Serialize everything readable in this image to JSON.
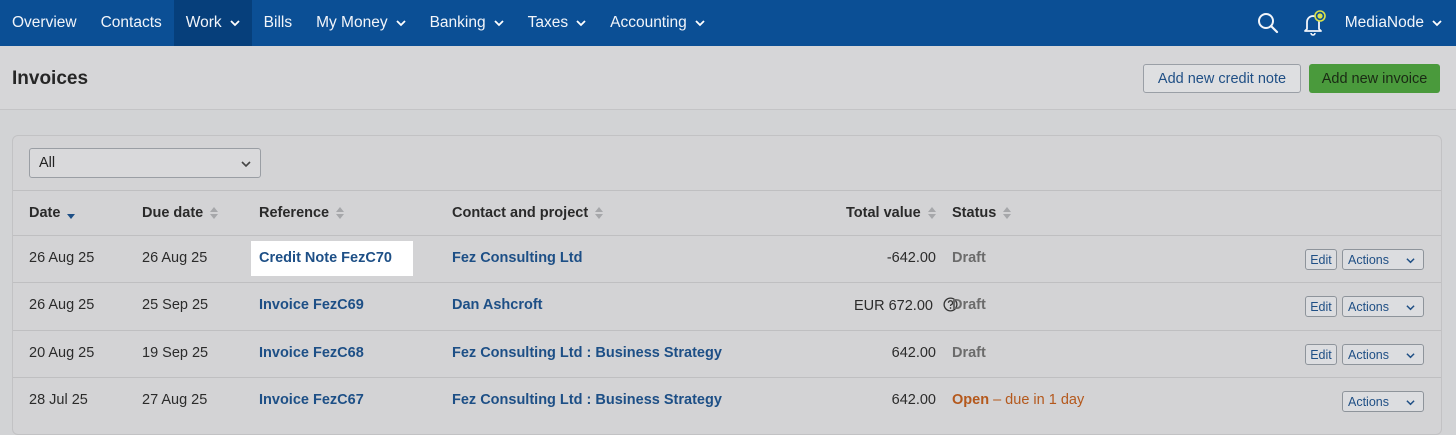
{
  "nav": {
    "items": [
      {
        "label": "Overview",
        "has_menu": false,
        "active": false
      },
      {
        "label": "Contacts",
        "has_menu": false,
        "active": false
      },
      {
        "label": "Work",
        "has_menu": true,
        "active": true
      },
      {
        "label": "Bills",
        "has_menu": false,
        "active": false
      },
      {
        "label": "My Money",
        "has_menu": true,
        "active": false
      },
      {
        "label": "Banking",
        "has_menu": true,
        "active": false
      },
      {
        "label": "Taxes",
        "has_menu": true,
        "active": false
      },
      {
        "label": "Accounting",
        "has_menu": true,
        "active": false
      }
    ],
    "search_icon": "search-icon",
    "bell_icon": "bell-icon",
    "account_label": "MediaNode"
  },
  "header": {
    "title": "Invoices",
    "credit_note_button": "Add new credit note",
    "invoice_button": "Add new invoice"
  },
  "filter": {
    "selected": "All"
  },
  "table": {
    "columns": {
      "date": "Date",
      "due_date": "Due date",
      "reference": "Reference",
      "contact": "Contact and project",
      "total": "Total value",
      "status": "Status"
    },
    "sorted_by": "Date",
    "rows": [
      {
        "date": "26 Aug 25",
        "due_date": "26 Aug 25",
        "reference": "Credit Note FezC70",
        "contact": "Fez Consulting Ltd",
        "total": "-642.00",
        "status": "Draft",
        "status_detail": "",
        "edit": "Edit",
        "actions": "Actions",
        "highlighted": true
      },
      {
        "date": "26 Aug 25",
        "due_date": "25 Sep 25",
        "reference": "Invoice FezC69",
        "contact": "Dan Ashcroft",
        "total": "EUR 672.00",
        "status": "Draft",
        "status_detail": "",
        "edit": "Edit",
        "actions": "Actions",
        "highlighted": false
      },
      {
        "date": "20 Aug 25",
        "due_date": "19 Sep 25",
        "reference": "Invoice FezC68",
        "contact": "Fez Consulting Ltd : Business Strategy",
        "total": "642.00",
        "status": "Draft",
        "status_detail": "",
        "edit": "Edit",
        "actions": "Actions",
        "highlighted": false
      },
      {
        "date": "28 Jul 25",
        "due_date": "27 Aug 25",
        "reference": "Invoice FezC67",
        "contact": "Fez Consulting Ltd : Business Strategy",
        "total": "642.00",
        "status": "Open",
        "status_detail": "– due in 1 day",
        "edit": "",
        "actions": "Actions",
        "highlighted": false
      }
    ]
  },
  "colors": {
    "nav_bg": "#0b4f95",
    "link": "#1d4f86",
    "accent_green": "#4a9a3c",
    "open_status": "#b4581c"
  }
}
